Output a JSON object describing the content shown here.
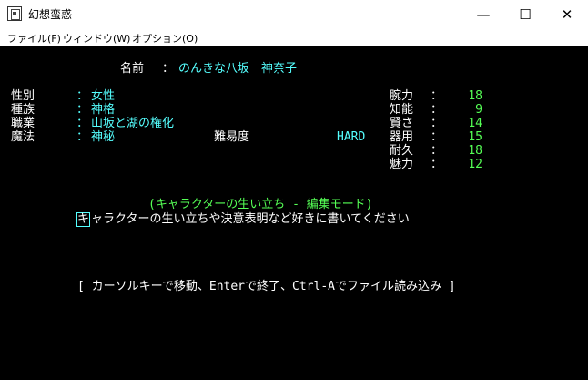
{
  "window": {
    "title": "幻想蛮惑",
    "controls": {
      "minimize": "—",
      "maximize": "☐",
      "close": "✕"
    }
  },
  "menu": [
    "ファイル(F)",
    "ウィンドウ(W)",
    "オプション(O)"
  ],
  "character": {
    "name_label": "名前",
    "name_sep": "：",
    "name_value": "のんきな八坂　神奈子",
    "rows": [
      {
        "label": "性別",
        "sep": "：",
        "value": "女性"
      },
      {
        "label": "種族",
        "sep": "：",
        "value": "神格"
      },
      {
        "label": "職業",
        "sep": "：",
        "value": "山坂と湖の権化"
      },
      {
        "label": "魔法",
        "sep": "：",
        "value": "神秘"
      }
    ],
    "difficulty_label": "難易度",
    "difficulty_value": "HARD",
    "stats": [
      {
        "label": "腕力",
        "sep": "：",
        "value": "18"
      },
      {
        "label": "知能",
        "sep": "：",
        "value": "9"
      },
      {
        "label": "賢さ",
        "sep": "：",
        "value": "14"
      },
      {
        "label": "器用",
        "sep": "：",
        "value": "15"
      },
      {
        "label": "耐久",
        "sep": "：",
        "value": "18"
      },
      {
        "label": "魅力",
        "sep": "：",
        "value": "12"
      }
    ]
  },
  "editor": {
    "mode_title": "(キャラクターの生い立ち - 編集モード)",
    "cursor_char": "キ",
    "text_rest": "ャラクターの生い立ちや決意表明など好きに書いてください",
    "help": "[ カーソルキーで移動、Enterで終了、Ctrl-Aでファイル読み込み ]"
  }
}
